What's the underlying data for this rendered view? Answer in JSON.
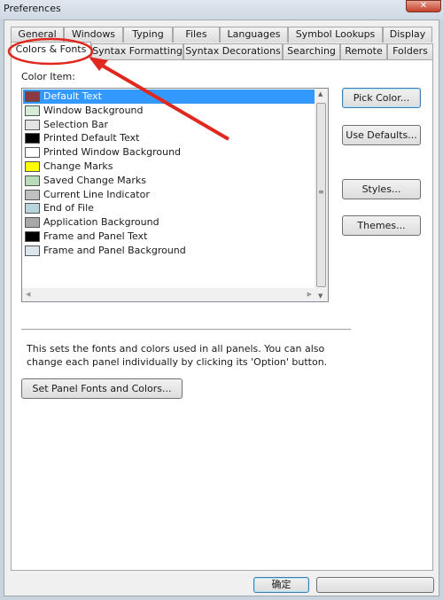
{
  "window": {
    "title": "Preferences",
    "close_icon": "close-icon"
  },
  "tabs_row1": [
    "General",
    "Windows",
    "Typing",
    "Files",
    "Languages",
    "Symbol Lookups",
    "Display"
  ],
  "tabs_row2": [
    "Colors & Fonts",
    "Syntax Formatting",
    "Syntax Decorations",
    "Searching",
    "Remote",
    "Folders"
  ],
  "active_tab": "Colors & Fonts",
  "color_item_label": "Color Item:",
  "color_items": [
    {
      "label": "Default Text",
      "color": "#8b3a44",
      "selected": true
    },
    {
      "label": "Window Background",
      "color": "#d4ecd8"
    },
    {
      "label": "Selection Bar",
      "color": "#e4e4e4"
    },
    {
      "label": "Printed Default Text",
      "color": "#000000"
    },
    {
      "label": "Printed Window Background",
      "color": "#ffffff"
    },
    {
      "label": "Change Marks",
      "color": "#ffff00"
    },
    {
      "label": "Saved Change Marks",
      "color": "#b8dcb8"
    },
    {
      "label": "Current Line Indicator",
      "color": "#c0c0c0"
    },
    {
      "label": "End of File",
      "color": "#b8d4dc"
    },
    {
      "label": "Application Background",
      "color": "#a8a8a8"
    },
    {
      "label": "Frame and Panel Text",
      "color": "#000000"
    },
    {
      "label": "Frame and Panel Background",
      "color": "#dce4ec"
    }
  ],
  "buttons": {
    "pick_color": "Pick Color...",
    "use_defaults": "Use Defaults...",
    "styles": "Styles...",
    "themes": "Themes..."
  },
  "description": "This sets the fonts and colors used in all panels. You can also change each panel individually by clicking its 'Option' button.",
  "set_panel_button": "Set Panel Fonts and Colors...",
  "footer": {
    "ok": "确定",
    "other": ""
  },
  "annotation_color": "#e0281e"
}
